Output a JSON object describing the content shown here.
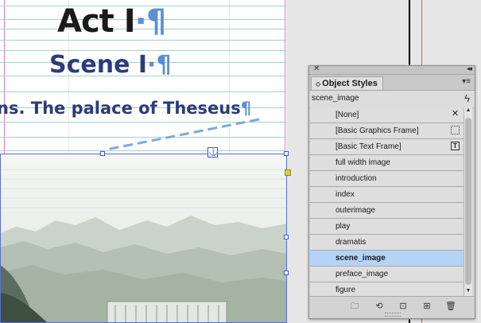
{
  "document": {
    "heading_act": "Act I",
    "heading_scene": "Scene I",
    "heading_place": "ns. The palace of Theseus",
    "pilcrow": "¶",
    "hidden_char": "·"
  },
  "panel": {
    "close_glyph": "✕",
    "collapse_glyph": "◂◂",
    "tab_label": "Object Styles",
    "tab_arrows": "◇",
    "menu_glyph": "▾≡",
    "current_style": "scene_image",
    "lightning_icon": "ϟ",
    "items": [
      {
        "label": "[None]",
        "icon": "none-style-icon",
        "glyph": "✕"
      },
      {
        "label": "[Basic Graphics Frame]",
        "icon": "graphics-frame-icon",
        "glyph": ""
      },
      {
        "label": "[Basic Text Frame]",
        "icon": "text-frame-icon",
        "glyph": "T"
      },
      {
        "label": "full width image"
      },
      {
        "label": "introduction"
      },
      {
        "label": "index"
      },
      {
        "label": "outerimage"
      },
      {
        "label": "play"
      },
      {
        "label": "dramatis"
      },
      {
        "label": "scene_image",
        "selected": true
      },
      {
        "label": "preface_image"
      },
      {
        "label": "figure"
      }
    ],
    "footer": {
      "new_group": "🗀",
      "clear_overrides": "⟲",
      "clear_non_defined": "⊡",
      "new_style": "⊞",
      "delete": "🗑"
    }
  },
  "colors": {
    "heading_dark": "#1a1a1a",
    "heading_blue": "#2e3a7c",
    "selection": "#b5d3f7",
    "frame_blue": "#3b5bdb"
  }
}
